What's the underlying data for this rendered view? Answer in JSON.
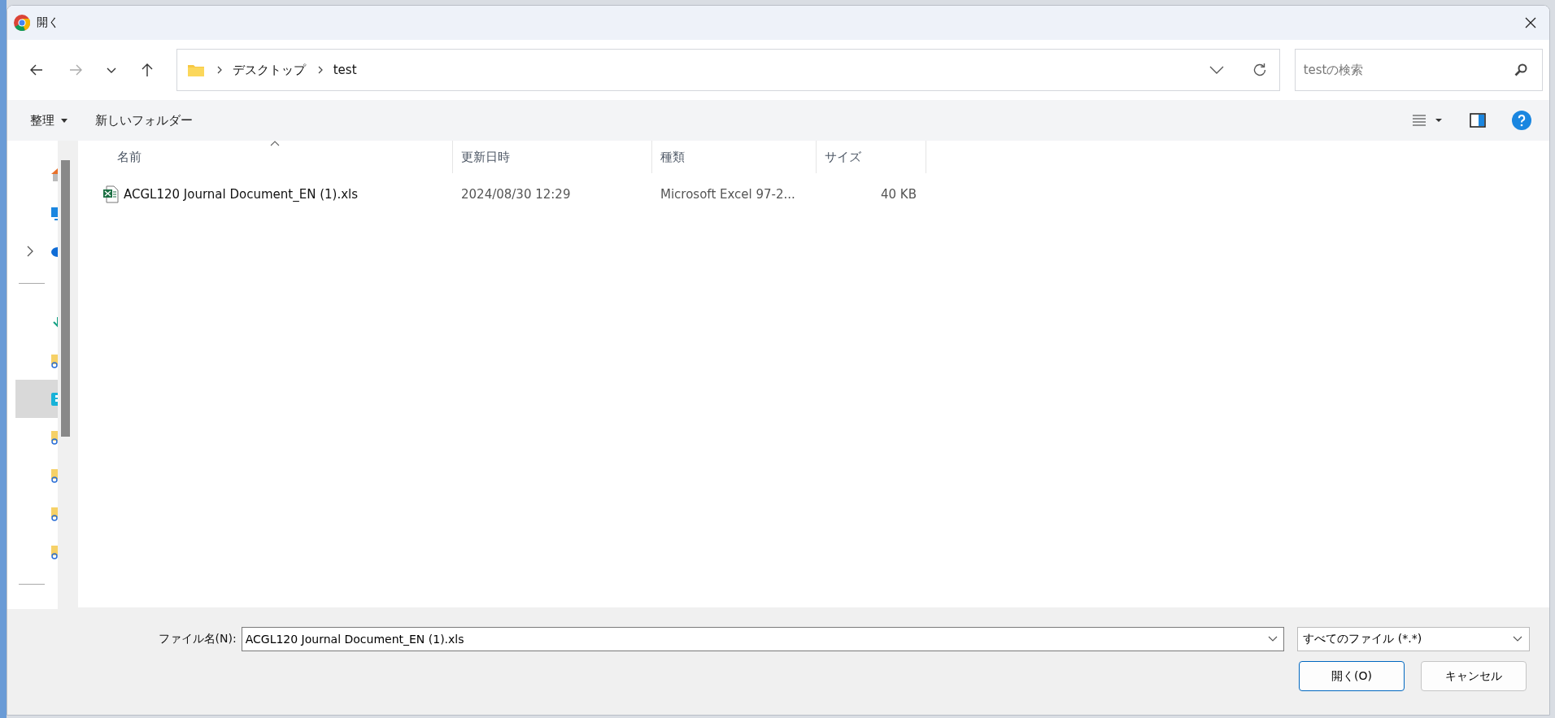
{
  "dialog": {
    "title": "開く"
  },
  "navigation": {
    "back": {
      "disabled": false
    },
    "forward": {
      "disabled": true
    }
  },
  "address_bar": {
    "path": [
      "デスクトップ",
      "test"
    ]
  },
  "search": {
    "placeholder": "testの検索"
  },
  "toolbar": {
    "organize": "整理",
    "new_folder": "新しいフォルダー"
  },
  "nav_pane": {
    "items": [
      {
        "kind": "home",
        "expandable": false,
        "selected": false
      },
      {
        "kind": "desktop",
        "expandable": false,
        "selected": false
      },
      {
        "kind": "cloud",
        "expandable": true,
        "selected": false
      },
      {
        "kind": "divider"
      },
      {
        "kind": "download",
        "expandable": false,
        "selected": false
      },
      {
        "kind": "shared-folder",
        "expandable": false,
        "selected": false
      },
      {
        "kind": "app",
        "expandable": false,
        "selected": true
      },
      {
        "kind": "shared-folder",
        "expandable": false,
        "selected": false
      },
      {
        "kind": "shared-folder",
        "expandable": false,
        "selected": false
      },
      {
        "kind": "shared-folder",
        "expandable": false,
        "selected": false
      },
      {
        "kind": "shared-folder",
        "expandable": false,
        "selected": false
      },
      {
        "kind": "divider"
      }
    ]
  },
  "columns": [
    {
      "label": "名前",
      "sorted": true
    },
    {
      "label": "更新日時",
      "sorted": false
    },
    {
      "label": "種類",
      "sorted": false
    },
    {
      "label": "サイズ",
      "sorted": false
    }
  ],
  "files": [
    {
      "kind": "excel",
      "name": "ACGL120 Journal Document_EN (1).xls",
      "modified": "2024/08/30 12:29",
      "type": "Microsoft Excel 97-2...",
      "size": "40 KB"
    }
  ],
  "footer": {
    "file_name_label": "ファイル名(N):",
    "file_name": "ACGL120 Journal Document_EN (1).xls",
    "filter": "すべてのファイル (*.*)",
    "open_button": "開く(O)",
    "cancel_button": "キャンセル"
  }
}
